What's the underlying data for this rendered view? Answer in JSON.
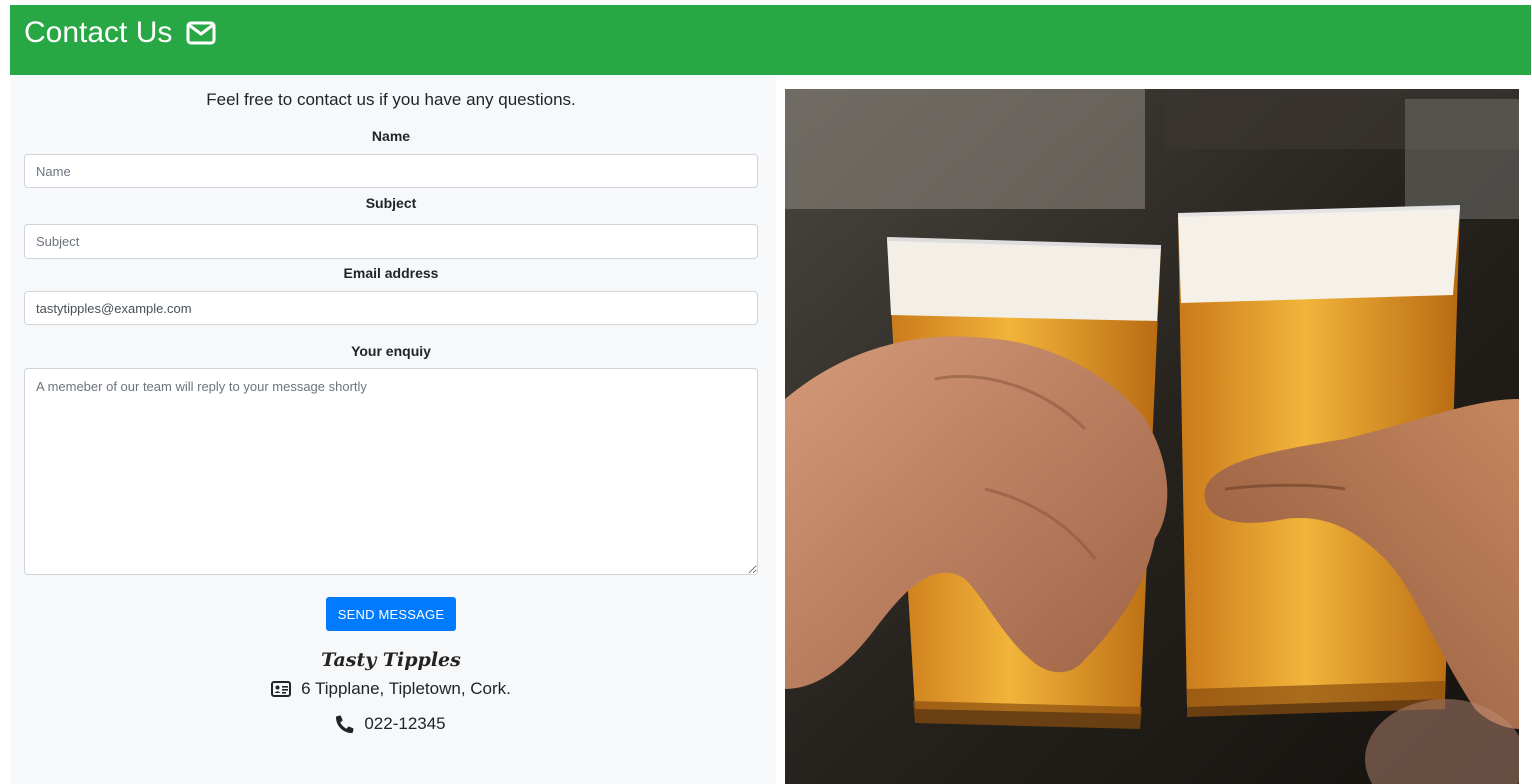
{
  "header": {
    "title": "Contact Us",
    "icon": "envelope-icon"
  },
  "form": {
    "intro": "Feel free to contact us if you have any questions.",
    "name_label": "Name",
    "name_placeholder": "Name",
    "subject_label": "Subject",
    "subject_placeholder": "Subject",
    "email_label": "Email address",
    "email_value": "tastytipples@example.com",
    "enquiry_label": "Your enquiy",
    "enquiry_placeholder": "A memeber of our team will reply to your message shortly",
    "send_label": "SEND MESSAGE"
  },
  "contact": {
    "brand": "Tasty Tipples",
    "address": "6 Tipplane, Tipletown, Cork.",
    "address_icon": "address-card-icon",
    "phone": "022-12345",
    "phone_icon": "phone-icon"
  },
  "colors": {
    "header_bg": "#28a745",
    "button_bg": "#007bff",
    "panel_bg": "#f7f8f9"
  }
}
